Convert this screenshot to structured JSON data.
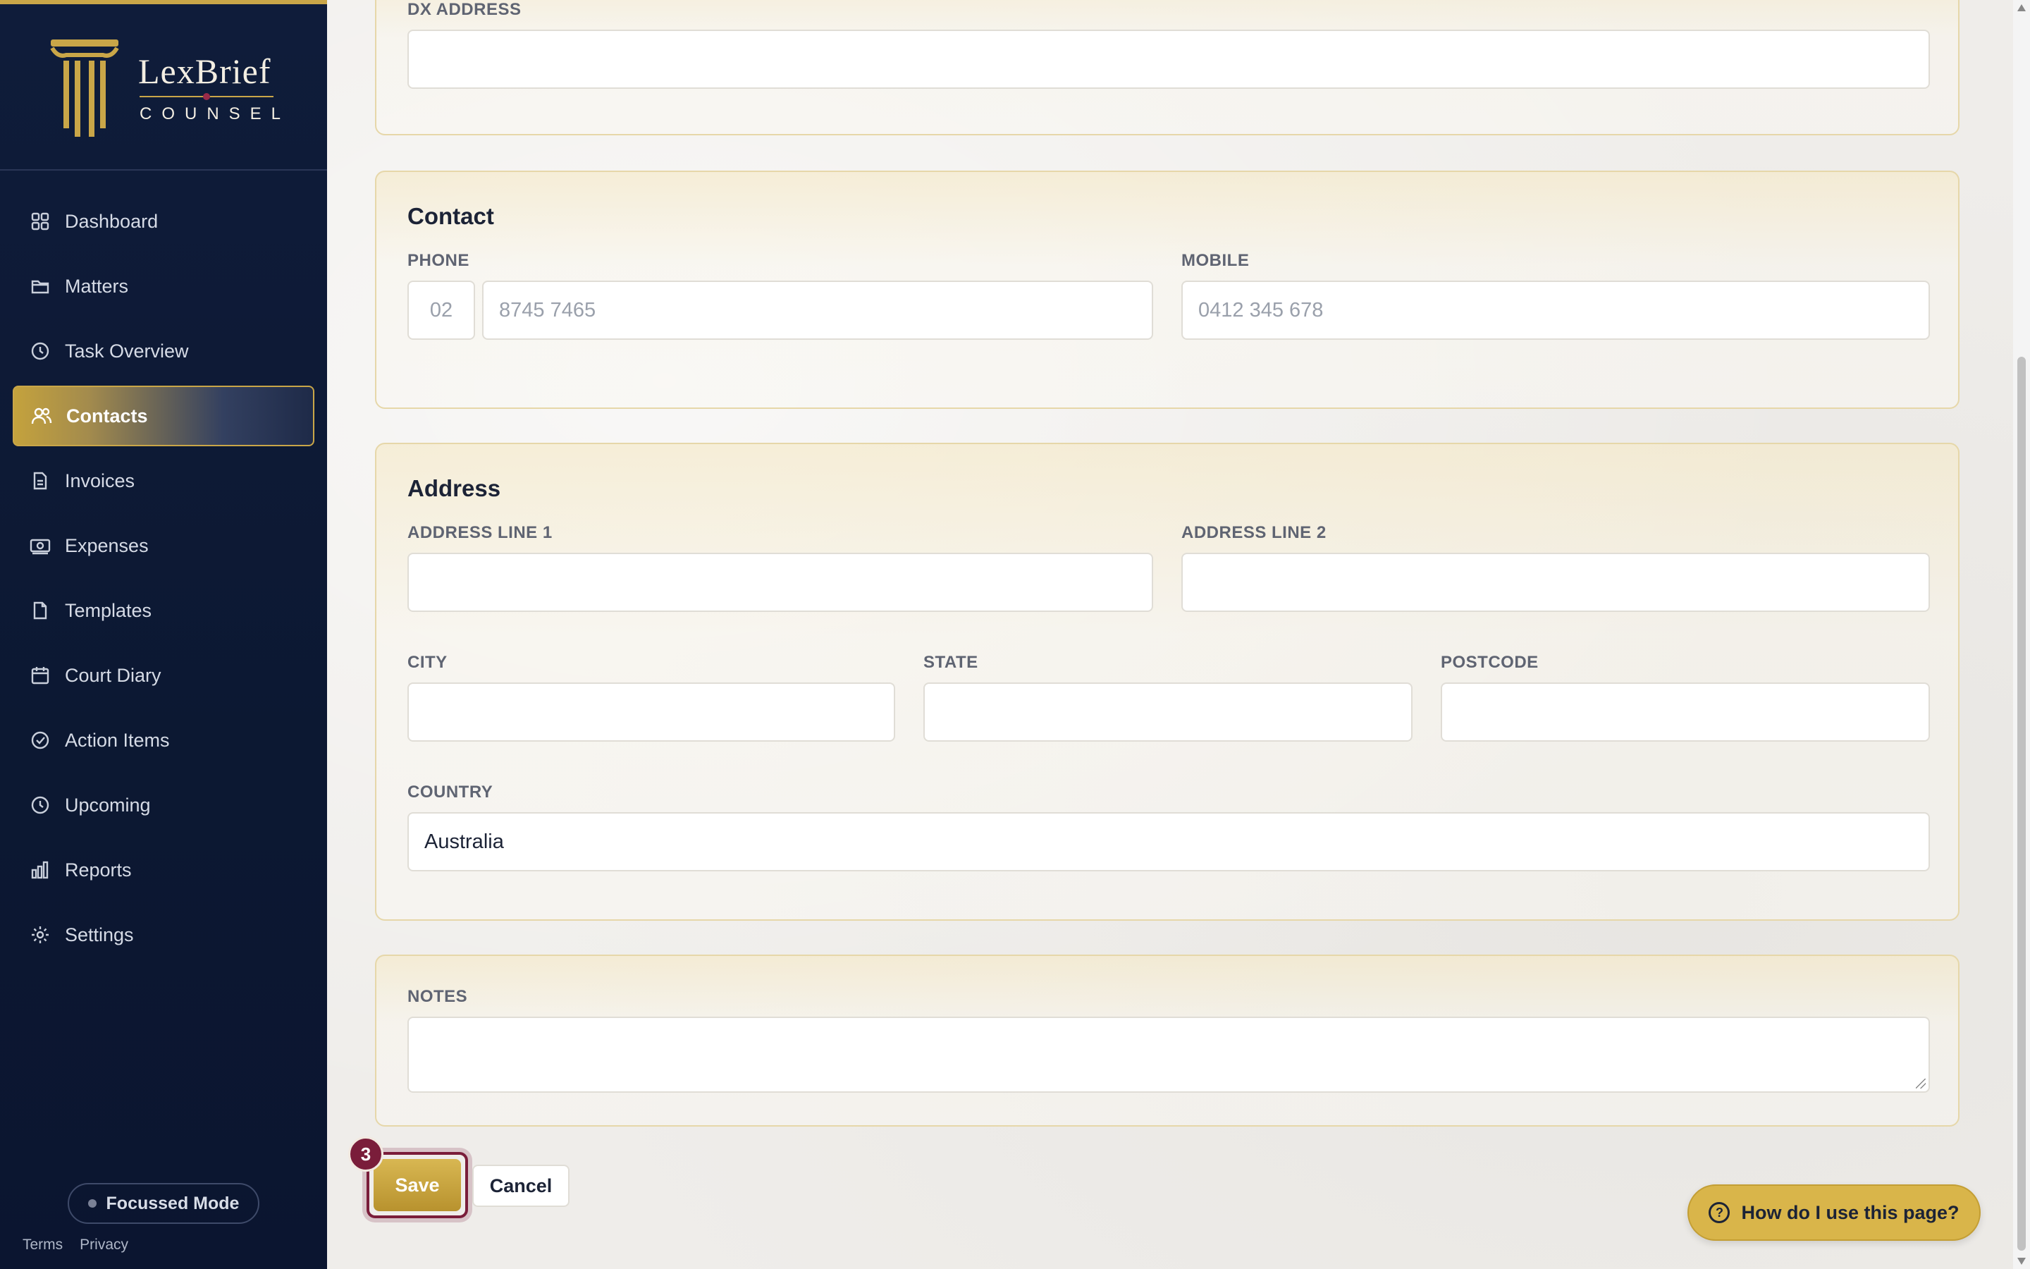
{
  "brand": {
    "name": "LexBrief",
    "sub": "COUNSEL"
  },
  "sidebar": {
    "items": [
      {
        "label": "Dashboard",
        "icon": "grid-icon"
      },
      {
        "label": "Matters",
        "icon": "folder-icon"
      },
      {
        "label": "Task Overview",
        "icon": "clock-icon"
      },
      {
        "label": "Contacts",
        "icon": "users-icon",
        "active": true
      },
      {
        "label": "Invoices",
        "icon": "invoice-icon"
      },
      {
        "label": "Expenses",
        "icon": "cash-icon"
      },
      {
        "label": "Templates",
        "icon": "file-icon"
      },
      {
        "label": "Court Diary",
        "icon": "calendar-icon"
      },
      {
        "label": "Action Items",
        "icon": "check-circle-icon"
      },
      {
        "label": "Upcoming",
        "icon": "clock-icon"
      },
      {
        "label": "Reports",
        "icon": "bar-chart-icon"
      },
      {
        "label": "Settings",
        "icon": "gear-icon"
      }
    ],
    "focus_mode": "Focussed Mode",
    "terms": "Terms",
    "privacy": "Privacy"
  },
  "dx": {
    "label": "DX ADDRESS",
    "value": ""
  },
  "contact": {
    "title": "Contact",
    "phone_label": "PHONE",
    "phone_area_placeholder": "02",
    "phone_placeholder": "8745 7465",
    "mobile_label": "MOBILE",
    "mobile_placeholder": "0412 345 678"
  },
  "address": {
    "title": "Address",
    "line1_label": "ADDRESS LINE 1",
    "line2_label": "ADDRESS LINE 2",
    "city_label": "CITY",
    "state_label": "STATE",
    "postcode_label": "POSTCODE",
    "country_label": "COUNTRY",
    "country_value": "Australia"
  },
  "notes": {
    "label": "NOTES"
  },
  "actions": {
    "save": "Save",
    "cancel": "Cancel",
    "step": "3"
  },
  "help": {
    "label": "How do I use this page?"
  },
  "colors": {
    "navy": "#0f1c3a",
    "gold": "#c9a648",
    "maroon": "#7a1d3a"
  }
}
